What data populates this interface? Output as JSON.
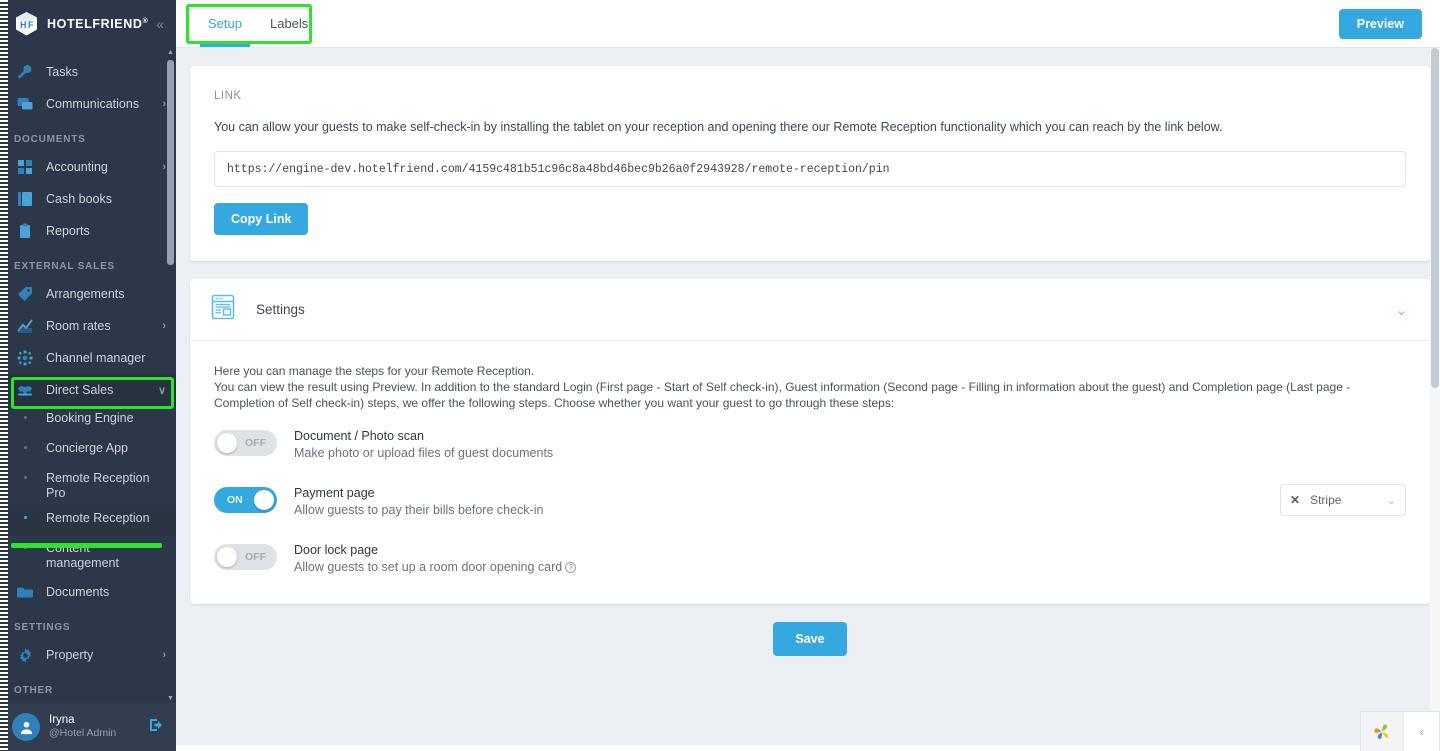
{
  "brand": {
    "name": "HOTELFRIEND",
    "reg": "®",
    "collapse_icon": "chevrons-left-icon"
  },
  "sidebar": {
    "items": [
      {
        "label": "Tasks",
        "icon": "wrench-icon",
        "chevron": ""
      },
      {
        "label": "Communications",
        "icon": "chat-icon",
        "chevron": "›"
      }
    ],
    "sections": [
      {
        "title": "DOCUMENTS",
        "items": [
          {
            "label": "Accounting",
            "icon": "calculator-icon",
            "chevron": "›"
          },
          {
            "label": "Cash books",
            "icon": "cashbook-icon",
            "chevron": ""
          },
          {
            "label": "Reports",
            "icon": "clipboard-icon",
            "chevron": ""
          }
        ]
      },
      {
        "title": "EXTERNAL SALES",
        "items": [
          {
            "label": "Arrangements",
            "icon": "tag-icon",
            "chevron": ""
          },
          {
            "label": "Room rates",
            "icon": "chart-icon",
            "chevron": "›"
          },
          {
            "label": "Channel manager",
            "icon": "network-icon",
            "chevron": ""
          },
          {
            "label": "Direct Sales",
            "icon": "handshake-icon",
            "chevron": "∨"
          }
        ],
        "subitems": [
          {
            "label": "Booking Engine",
            "active": false
          },
          {
            "label": "Concierge App",
            "active": false
          },
          {
            "label": "Remote Reception Pro",
            "active": false
          },
          {
            "label": "Remote Reception",
            "active": true
          },
          {
            "label": "Content management",
            "active": false
          }
        ],
        "after": [
          {
            "label": "Documents",
            "icon": "folder-icon",
            "chevron": ""
          }
        ]
      },
      {
        "title": "SETTINGS",
        "items": [
          {
            "label": "Property",
            "icon": "gear-icon",
            "chevron": "›"
          }
        ]
      },
      {
        "title": "OTHER",
        "items": []
      }
    ]
  },
  "user": {
    "name": "Iryna",
    "role": "@Hotel Admin",
    "logout_icon": "logout-icon",
    "avatar_icon": "user-icon"
  },
  "topbar": {
    "tabs": [
      {
        "label": "Setup",
        "active": true
      },
      {
        "label": "Labels",
        "active": false
      }
    ],
    "preview_label": "Preview"
  },
  "link_card": {
    "section_label": "LINK",
    "description": "You can allow your guests to make self-check-in by installing the tablet on your reception and opening there our Remote Reception functionality which you can reach by the link below.",
    "url": "https://engine-dev.hotelfriend.com/4159c481b51c96c8a48bd46bec9b26a0f2943928/remote-reception/pin",
    "copy_label": "Copy Link"
  },
  "settings_card": {
    "icon": "settings-page-icon",
    "title": "Settings",
    "collapse_icon": "chevron-down-icon",
    "description_line1": "Here you can manage the steps for your Remote Reception.",
    "description_line2": "You can view the result using Preview. In addition to the standard Login (First page - Start of Self check-in), Guest information (Second page - Filling in information about the guest) and Completion page (Last page - Completion of Self check-in) steps, we offer the following steps. Choose whether you want your guest to go through these steps:",
    "toggles": [
      {
        "title": "Document / Photo scan",
        "subtitle": "Make photo or upload files of guest documents",
        "state": "OFF",
        "on": false,
        "help": false
      },
      {
        "title": "Payment page",
        "subtitle": "Allow guests to pay their bills before check-in",
        "state": "ON",
        "on": true,
        "help": false,
        "select": {
          "value": "Stripe",
          "clear_icon": "close-icon",
          "chevron": "chevron-down-icon"
        }
      },
      {
        "title": "Door lock page",
        "subtitle": "Allow guests to set up a room door opening card",
        "state": "OFF",
        "on": false,
        "help": true,
        "help_icon": "question-mark-icon"
      }
    ]
  },
  "footer": {
    "save_label": "Save"
  },
  "widget": {
    "logo_icon": "pinwheel-icon",
    "collapse_icon": "chevron-left-icon"
  },
  "colors": {
    "accent": "#36a8e0",
    "sidebar": "#2c3749",
    "highlight": "#2ae52a",
    "page_bg": "#eceff3"
  }
}
